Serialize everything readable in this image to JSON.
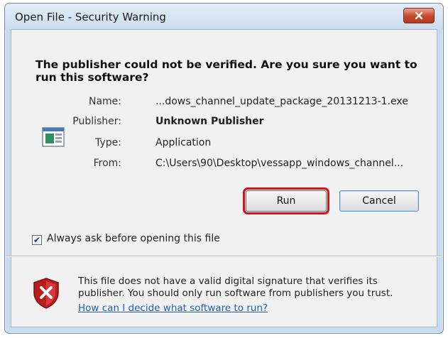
{
  "window": {
    "title": "Open File - Security Warning"
  },
  "dialog": {
    "headline": "The publisher could not be verified.  Are you sure you want to run this software?",
    "details": {
      "name_label": "Name:",
      "name_value": "...dows_channel_update_package_20131213-1.exe",
      "publisher_label": "Publisher:",
      "publisher_value": "Unknown Publisher",
      "type_label": "Type:",
      "type_value": "Application",
      "from_label": "From:",
      "from_value": "C:\\Users\\90\\Desktop\\vessapp_windows_channel..."
    },
    "buttons": {
      "run_label": "Run",
      "cancel_label": "Cancel"
    },
    "checkbox": {
      "label": "Always ask before opening this file",
      "checked": true
    },
    "footer": {
      "message": "This file does not have a valid digital signature that verifies its publisher.  You should only run software from publishers you trust.",
      "link_text": "How can I decide what software to run?"
    }
  },
  "colors": {
    "highlight_box": "#d01419",
    "link": "#1f5fb4",
    "close_button": "#c5462b"
  },
  "icons": {
    "close": "close-icon",
    "file": "application-file-icon",
    "warning": "security-shield-icon"
  }
}
